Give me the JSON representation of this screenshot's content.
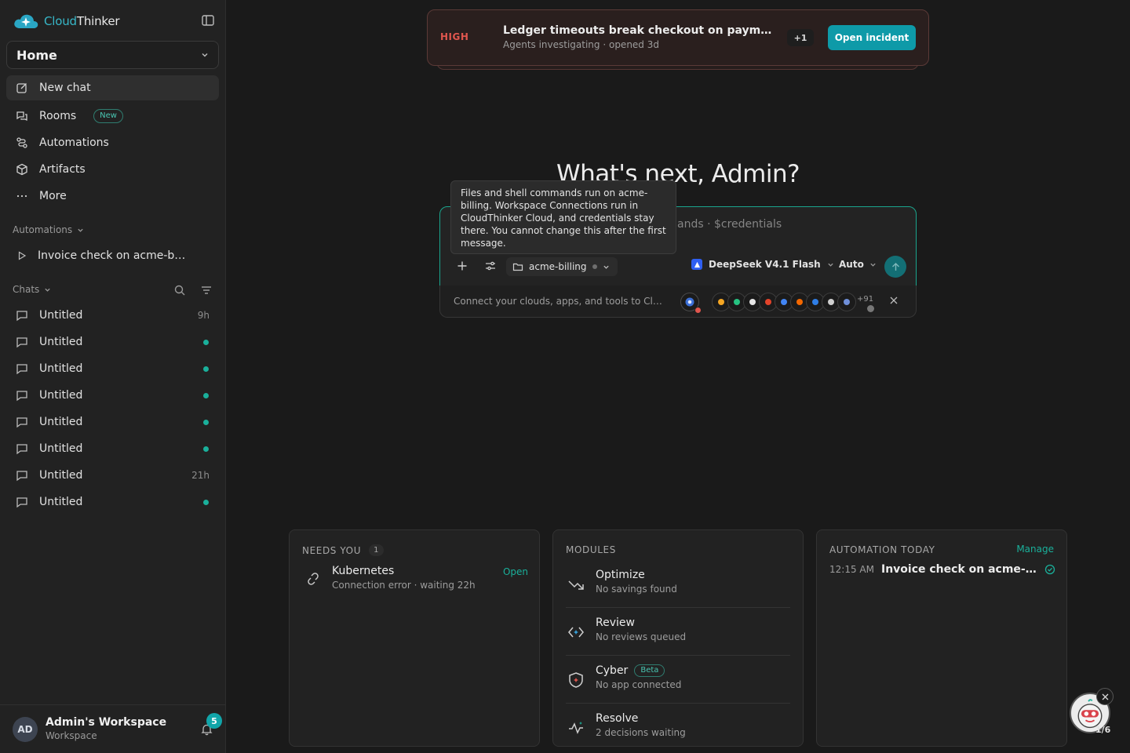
{
  "brand": {
    "part1": "Cloud",
    "part2": "Thinker"
  },
  "home_select": "Home",
  "nav": [
    {
      "label": "New chat",
      "icon": "edit-icon"
    },
    {
      "label": "Rooms",
      "icon": "chat-bubbles-icon",
      "badge": "New"
    },
    {
      "label": "Automations",
      "icon": "route-icon"
    },
    {
      "label": "Artifacts",
      "icon": "cube-icon"
    },
    {
      "label": "More",
      "icon": "ellipsis-icon"
    }
  ],
  "automations_section": {
    "label": "Automations",
    "items": [
      "Invoice check on acme-billing"
    ]
  },
  "chats_section": {
    "label": "Chats",
    "items": [
      {
        "title": "Untitled",
        "meta": "9h"
      },
      {
        "title": "Untitled",
        "unread": true
      },
      {
        "title": "Untitled",
        "unread": true
      },
      {
        "title": "Untitled",
        "unread": true
      },
      {
        "title": "Untitled",
        "unread": true
      },
      {
        "title": "Untitled",
        "unread": true
      },
      {
        "title": "Untitled",
        "meta": "21h"
      },
      {
        "title": "Untitled",
        "unread": true
      }
    ]
  },
  "workspace": {
    "initials": "AD",
    "name": "Admin's Workspace",
    "type": "Workspace",
    "notifications": "5"
  },
  "incident": {
    "severity": "HIGH",
    "title": "Ledger timeouts break checkout on payment service",
    "subtitle": "Agents investigating · opened 3d",
    "more": "+1",
    "action": "Open incident"
  },
  "greeting": "What's next, Admin?",
  "prompt": {
    "placeholder": "ands · $credentials",
    "workspace": "acme-billing",
    "model": "DeepSeek V4.1 Flash",
    "mode": "Auto"
  },
  "tooltip": "Files and shell commands run on acme-billing. Workspace Connections run in CloudThinker Cloud, and credentials stay there. You cannot change this after the first message.",
  "connect": {
    "text": "Connect your clouds, apps, and tools to CloudThinker",
    "integrations": [
      "aws",
      "s",
      "github",
      "gitlab",
      "gcp",
      "grafana",
      "azure",
      "vercel",
      "k8s"
    ],
    "more_count": "+91"
  },
  "needs_you": {
    "title": "NEEDS YOU",
    "count": "1",
    "item": {
      "title": "Kubernetes",
      "subtitle": "Connection error · waiting 22h",
      "action": "Open"
    }
  },
  "modules": {
    "title": "MODULES",
    "items": [
      {
        "title": "Optimize",
        "subtitle": "No savings found"
      },
      {
        "title": "Review",
        "subtitle": "No reviews queued"
      },
      {
        "title": "Cyber",
        "subtitle": "No app connected",
        "badge": "Beta"
      },
      {
        "title": "Resolve",
        "subtitle": "2 decisions waiting"
      }
    ]
  },
  "automation_today": {
    "title": "AUTOMATION TODAY",
    "action": "Manage",
    "item": {
      "time": "12:15 AM",
      "name": "Invoice check on acme-billing"
    }
  },
  "helper": {
    "count": "1/6"
  },
  "colors": {
    "accent": "#1ab09b",
    "danger": "#e0564e",
    "button": "#0e9aa8"
  }
}
